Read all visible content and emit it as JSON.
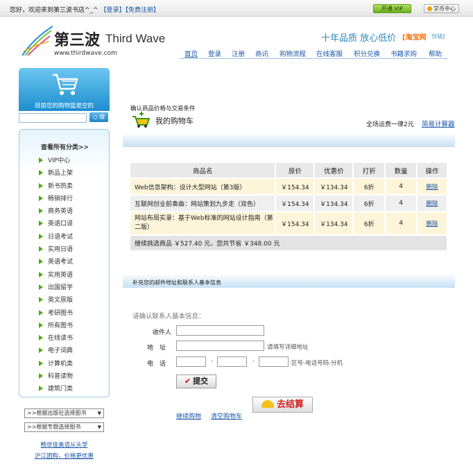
{
  "topbar": {
    "welcome": "您好，欢迎来到第三波书店^_^",
    "login": "【登录】",
    "register": "【免费注册】",
    "vip_btn": "开通 VIP",
    "coin_btn": "学币中心"
  },
  "header": {
    "logo_cn": "第三波",
    "logo_en": "Third Wave",
    "logo_url": "www.thirdwave.com",
    "slogan": "十年品质 放心低价",
    "taobao": "[淘宝网",
    "fendian": "分站]"
  },
  "nav": [
    "首页",
    "登录",
    "注册",
    "商讯",
    "购物流程",
    "在线客服",
    "积分兑换",
    "书籍求购",
    "帮助"
  ],
  "sidebar": {
    "cart_status": "目前您的购物篮是空的",
    "search_btn": "搜",
    "category_head": "查看所有分类>>",
    "categories": [
      "VIP中心",
      "新品上架",
      "新书热卖",
      "畅销排行",
      "商务英语",
      "英语口译",
      "日语考试",
      "实用日语",
      "英语考试",
      "实用英语",
      "出国留学",
      "英文原版",
      "考研图书",
      "所有图书",
      "在线读书",
      "电子词典",
      "计算机类",
      "科普读物",
      "建筑门类"
    ],
    "select_publisher": ">>根据出版社选择图书",
    "select_topic": ">>根据专题选择图书",
    "link1": "畅世佳美语从头学",
    "link2": "沪江团购，价格更优惠"
  },
  "main": {
    "caption": "确认商品价格与交易条件",
    "title": "我的购物车",
    "shipping": "全场运费一律2元",
    "calculator": "简易计算器",
    "headers": [
      "商品名",
      "原价",
      "优惠价",
      "打折",
      "数量",
      "操作"
    ],
    "rows": [
      {
        "name": "Web信息架构：设计大型网站（第3版）",
        "orig": "￥154.34",
        "sale": "￥134.34",
        "disc": "6折",
        "qty": "4",
        "op": "删除"
      },
      {
        "name": "互联网创业前奏曲：网站策划九步走（双色）",
        "orig": "￥154.34",
        "sale": "￥134.34",
        "disc": "6折",
        "qty": "4",
        "op": "删除"
      },
      {
        "name": "网站布局实录：基于Web标准的网站设计指南（第二版）",
        "orig": "￥154.34",
        "sale": "￥134.34",
        "disc": "6折",
        "qty": "4",
        "op": "删除"
      }
    ],
    "summary": "继续挑选商品 ￥527.40 元，您共节省 ￥348.00 元",
    "address_bar": "补充您的邮件地址和联系人基本信息",
    "confirm_info": "请确认联系人基本信息：",
    "label_recipient": "收件人",
    "label_address": "地　址",
    "address_hint": "请填写详细地址",
    "label_phone": "电　话",
    "phone_sep": "-",
    "phone_hint": "区号-电话号码-分机",
    "submit": "提交",
    "continue_shopping": "继续购物",
    "clear_cart": "清空购物车",
    "checkout": "去结算"
  }
}
